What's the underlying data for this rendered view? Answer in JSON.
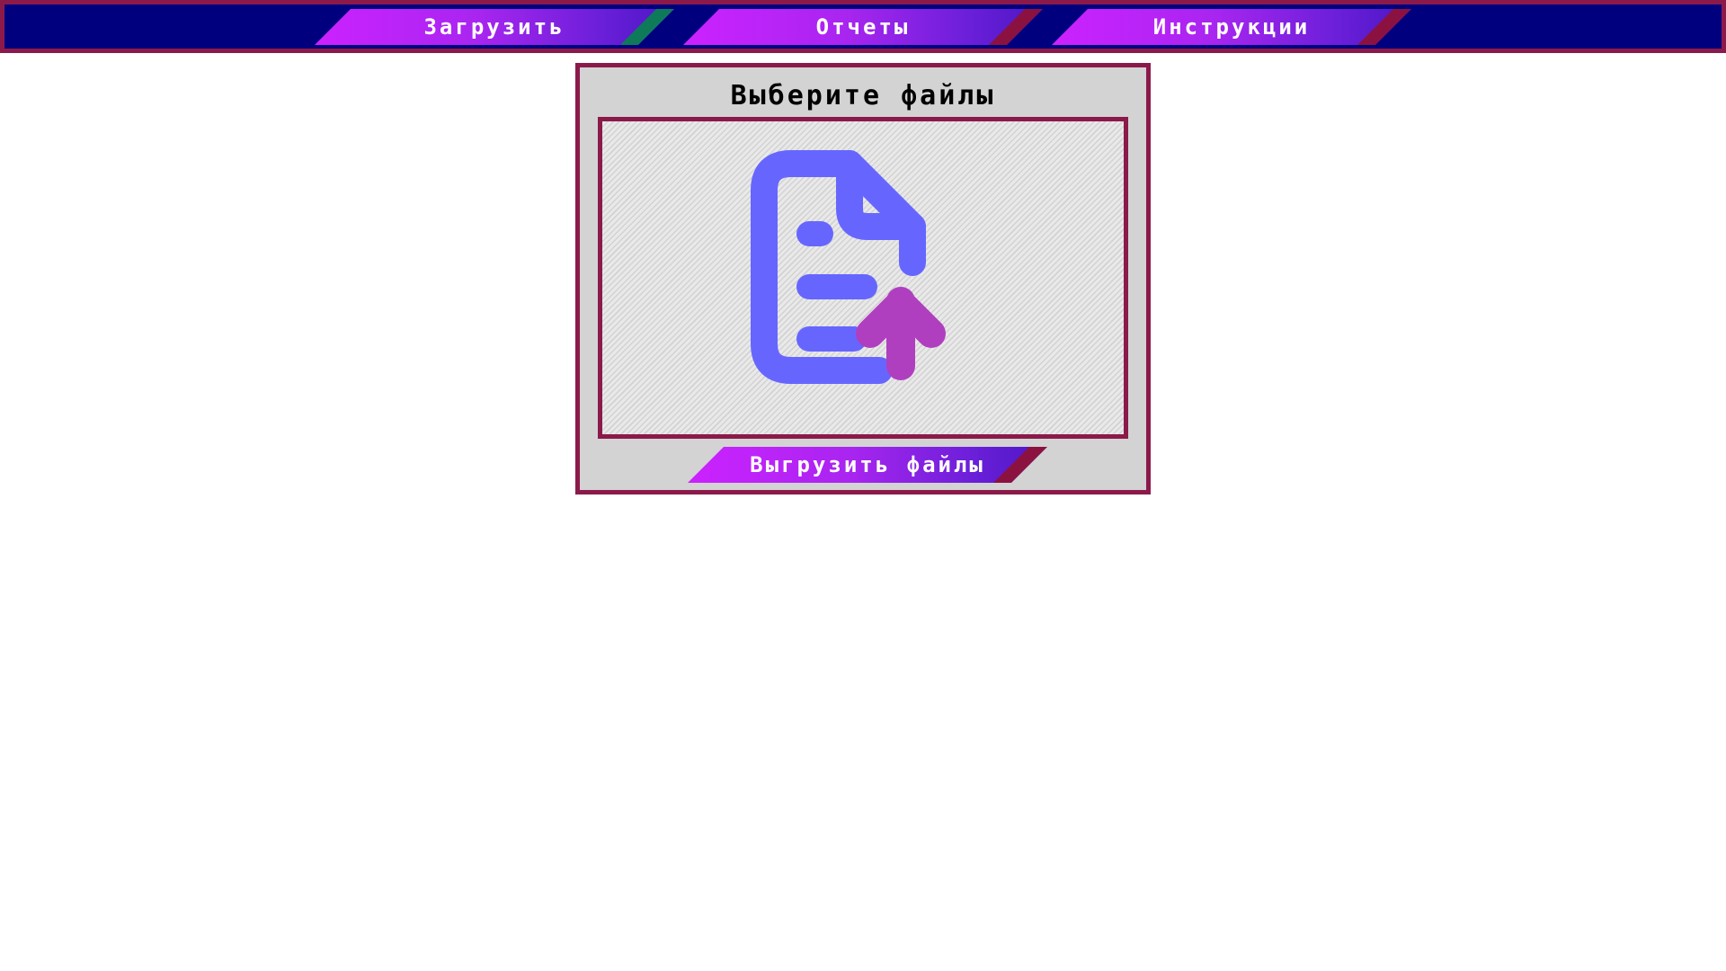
{
  "nav": {
    "items": [
      {
        "label": "Загрузить"
      },
      {
        "label": "Отчеты"
      },
      {
        "label": "Инструкции"
      }
    ]
  },
  "upload": {
    "title": "Выберите файлы",
    "button_label": "Выгрузить файлы",
    "icon": "file-upload-icon"
  },
  "colors": {
    "nav_background": "#00007f",
    "border": "#8b1a4a",
    "button_gradient_start": "#cc22ff",
    "button_gradient_end": "#4b16c4",
    "accent_green": "#0e7a5a",
    "accent_crimson": "#8b1240",
    "icon_document": "#6666ff",
    "icon_arrow": "#b03fc0",
    "panel_background": "#d3d3d3"
  }
}
